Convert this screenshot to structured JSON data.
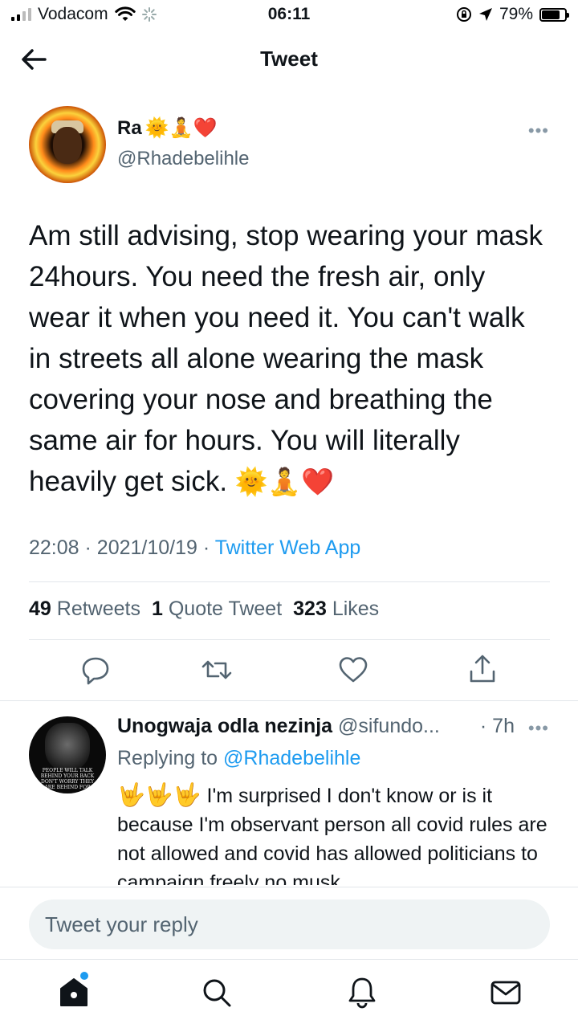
{
  "status_bar": {
    "carrier": "Vodacom",
    "time": "06:11",
    "battery": "79%",
    "battery_level": 0.79
  },
  "header": {
    "title": "Tweet"
  },
  "tweet": {
    "author_name": "Ra",
    "author_emojis": "🌞🧘❤️",
    "handle": "@Rhadebelihle",
    "text": "Am still advising, stop wearing your mask 24hours. You need the fresh air, only wear it when you need it. You can't walk in streets all alone wearing the mask covering your nose and breathing the same air for hours. You will literally heavily get sick.",
    "text_emojis": "🌞🧘❤️",
    "time": "22:08",
    "date": "2021/10/19",
    "source": "Twitter Web App",
    "retweets_count": "49",
    "retweets_label": "Retweets",
    "quotes_count": "1",
    "quotes_label": "Quote Tweet",
    "likes_count": "323",
    "likes_label": "Likes"
  },
  "reply": {
    "author_name": "Unogwaja odla nezinja",
    "handle": "@sifundo...",
    "time": "· 7h",
    "replying_label": "Replying to",
    "replying_to": "@Rhadebelihle",
    "avatar_text": "PEOPLE WILL TALK BEHIND YOUR BACK DON'T WORRY THEY ARE BEHIND FOR",
    "emojis": "🤟🤟🤟",
    "text": "I'm surprised I don't know or is it because  I'm observant person all covid rules are not allowed and covid has allowed politicians to campaign  freely no musk"
  },
  "composer": {
    "placeholder": "Tweet your reply"
  },
  "icons": [
    "back-arrow-icon",
    "more-icon",
    "reply-icon",
    "retweet-icon",
    "like-icon",
    "share-icon",
    "home-icon",
    "search-icon",
    "notifications-icon",
    "messages-icon"
  ]
}
